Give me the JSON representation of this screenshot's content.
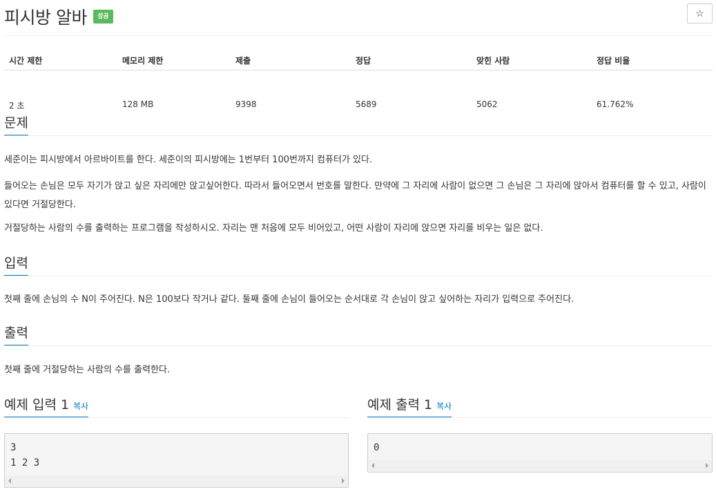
{
  "problem": {
    "title": "피시방 알바",
    "badge": "성공",
    "star_icon": "☆"
  },
  "stats": {
    "headers": [
      "시간 제한",
      "메모리 제한",
      "제출",
      "정답",
      "맞힌 사람",
      "정답 비율"
    ],
    "values": [
      "2 초",
      "128 MB",
      "9398",
      "5689",
      "5062",
      "61.762%"
    ]
  },
  "sections": {
    "problem_label": "문제",
    "problem_paragraphs": [
      "세준이는 피시방에서 아르바이트를 한다. 세준이의 피시방에는 1번부터 100번까지 컴퓨터가 있다.",
      "들어오는 손님은 모두 자기가 앉고 싶은 자리에만 앉고싶어한다. 따라서 들어오면서 번호를 말한다. 만약에 그 자리에 사람이 없으면 그 손님은 그 자리에 앉아서 컴퓨터를 할 수 있고, 사람이 있다면 거절당한다.",
      "거절당하는 사람의 수를 출력하는 프로그램을 작성하시오. 자리는 맨 처음에 모두 비어있고, 어떤 사람이 자리에 앉으면 자리를 비우는 일은 없다."
    ],
    "input_label": "입력",
    "input_text": "첫째 줄에 손님의 수 N이 주어진다. N은 100보다 작거나 같다. 둘째 줄에 손님이 들어오는 순서대로 각 손님이 앉고 싶어하는 자리가 입력으로 주어진다.",
    "output_label": "출력",
    "output_text": "첫째 줄에 거절당하는 사람의 수를 출력한다."
  },
  "samples": {
    "input_label": "예제 입력 1",
    "output_label": "예제 출력 1",
    "copy_label": "복사",
    "input_text": "3\n1 2 3",
    "output_text": "0"
  }
}
